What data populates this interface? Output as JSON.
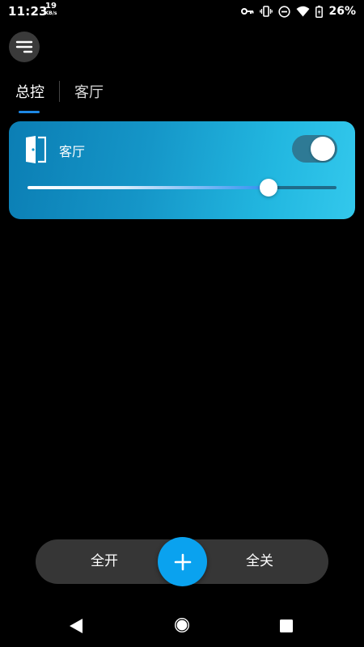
{
  "status_bar": {
    "time": "11:23",
    "net_speed_value": "19",
    "net_speed_unit": "KB/s",
    "battery_percent": "26%",
    "icons": [
      "key-icon",
      "vibrate-icon",
      "dnd-icon",
      "wifi-icon",
      "battery-icon"
    ]
  },
  "tabs": [
    {
      "label": "总控",
      "active": true
    },
    {
      "label": "客厅",
      "active": false
    }
  ],
  "room_card": {
    "name": "客厅",
    "icon": "door-icon",
    "switch_on": true,
    "brightness_fraction": 0.78
  },
  "controls": {
    "all_on_label": "全开",
    "all_off_label": "全关",
    "add_icon": "plus-icon"
  },
  "colors": {
    "accent": "#1e88e5",
    "fab": "#0aa2ef",
    "card_start": "#0b7eb4",
    "card_end": "#33c8ec",
    "control_bar": "#363636"
  }
}
